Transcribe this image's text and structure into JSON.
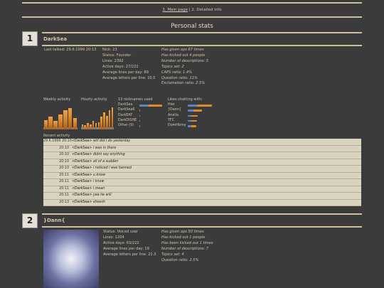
{
  "nav": {
    "link1": "1. Main page",
    "sep": " | ",
    "link2": "2. Detailed info"
  },
  "page_title": "Personal stats",
  "user1": {
    "rank": "1",
    "nick": "DarkSea",
    "last_talked": "Last talked: 29.6.1999 20:13",
    "col1": [
      "Nick: 23",
      "Status: Founder",
      "Lines: 2392",
      "Active days: 27/222",
      "Average lines per day: 89",
      "Average letters per line: 10.5"
    ],
    "col2": [
      "Has given ops 67 times",
      "Has kicked out 4 people",
      "Number of descriptions: 5",
      "Topics set: 2",
      "CAPS ratio: 1.4%",
      "Question ratio: 11%",
      "Exclamation ratio: 2.5%"
    ],
    "weekly_label": "Weekly activity",
    "hourly_label": "Hourly activity",
    "nicks_label": "13 nicknames used",
    "nicks": [
      "DarkSea",
      "DarkSea6",
      "DarkEAT",
      "DarkDISHE",
      "Other (9)"
    ],
    "chatting_label": "Likes chatting with:",
    "chatting": [
      "Hier",
      "}Dann{",
      "Anelia",
      "TFC",
      "DomHbmy"
    ],
    "recent_label": "Recent activity",
    "recent": [
      {
        "time": "29.6.1999 20:10",
        "nick": "<DarkSea>",
        "msg": "wtf did I do yesterday"
      },
      {
        "time": "20:10",
        "nick": "<DarkSea>",
        "msg": "i was in there"
      },
      {
        "time": "20:10",
        "nick": "<DarkSea>",
        "msg": "didnt say anything"
      },
      {
        "time": "20:10",
        "nick": "<DarkSea>",
        "msg": "all of a sudden"
      },
      {
        "time": "20:10",
        "nick": "<DarkSea>",
        "msg": "i noticed i was banned"
      },
      {
        "time": "20:11",
        "nick": "<DarkSea>",
        "msg": "u know"
      },
      {
        "time": "20:11",
        "nick": "<DarkSea>",
        "msg": "i know"
      },
      {
        "time": "20:11",
        "nick": "<DarkSea>",
        "msg": "i mean"
      },
      {
        "time": "20:11",
        "nick": "<DarkSea>",
        "msg": "yea he will"
      },
      {
        "time": "20:13",
        "nick": "<DarkSea>",
        "msg": "sheesh"
      }
    ],
    "weekly_values": [
      0.35,
      0.5,
      0.3,
      0.6,
      0.8,
      0.9,
      0.45
    ],
    "hourly_values": [
      0.15,
      0.1,
      0.2,
      0.12,
      0.3,
      0.2,
      0.25,
      0.5,
      0.7,
      0.55,
      0.8,
      0.95
    ],
    "nick_values": [
      0.95,
      0.03,
      0.03,
      0.03,
      0.03
    ],
    "chat_values": [
      1.0,
      0.6,
      0.4,
      0.38,
      0.35
    ]
  },
  "user2": {
    "rank": "2",
    "nick": "}Dann{",
    "col1": [
      "Status: Voiced user",
      "Lines: 1204",
      "Active days: 63/222",
      "Average lines per day: 19",
      "Average letters per line: 21.3"
    ],
    "col2": [
      "Has given ops 50 times",
      "Has kicked out 1 people",
      "Has been kicked out 1 times",
      "Number of descriptions: 7",
      "Topics set: 4",
      "Question ratio: 2.5%"
    ]
  },
  "colors": {
    "accent": "#cbbf9c",
    "bar_orange": "#e08a2a",
    "bar_blue": "#5a86c4"
  }
}
